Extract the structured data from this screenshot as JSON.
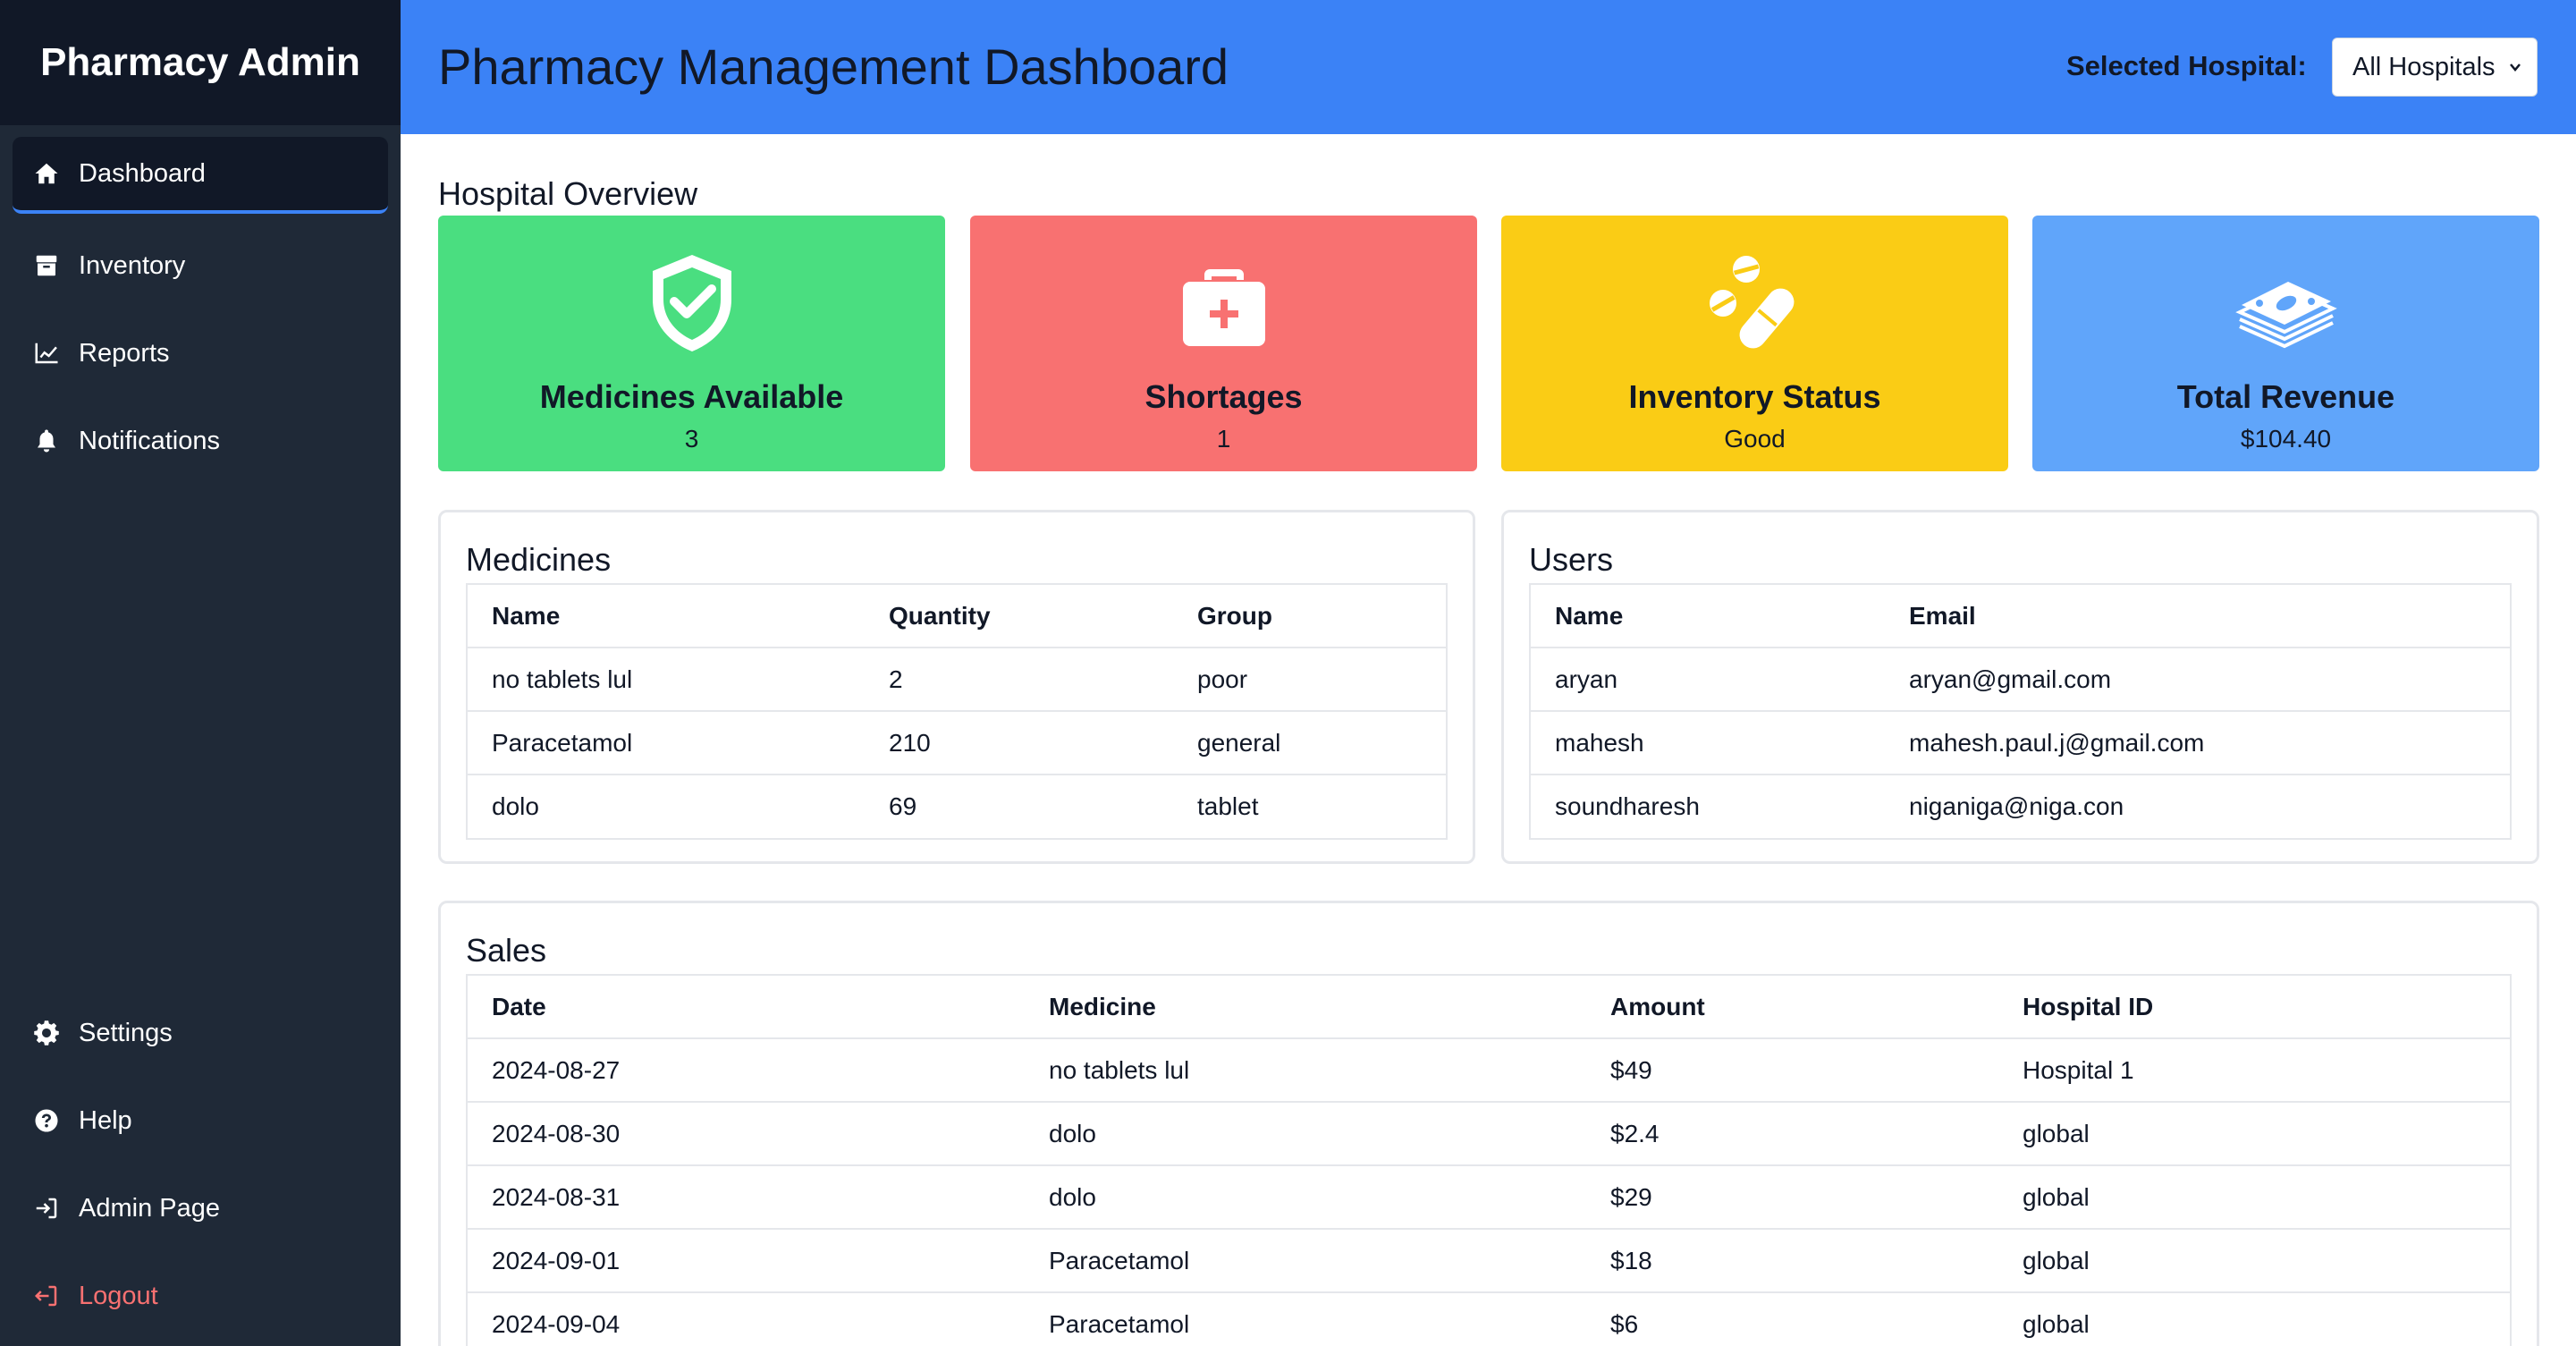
{
  "sidebar": {
    "brand": "Pharmacy Admin",
    "items": [
      {
        "label": "Dashboard",
        "icon": "home-icon"
      },
      {
        "label": "Inventory",
        "icon": "box-icon"
      },
      {
        "label": "Reports",
        "icon": "chart-line-icon"
      },
      {
        "label": "Notifications",
        "icon": "bell-icon"
      }
    ],
    "bottom_items": [
      {
        "label": "Settings",
        "icon": "gear-icon"
      },
      {
        "label": "Help",
        "icon": "question-circle-icon"
      },
      {
        "label": "Admin Page",
        "icon": "sign-in-icon"
      },
      {
        "label": "Logout",
        "icon": "sign-out-icon"
      }
    ]
  },
  "header": {
    "title": "Pharmacy Management Dashboard",
    "hospital_label": "Selected Hospital:",
    "hospital_selected": "All Hospitals"
  },
  "overview": {
    "title": "Hospital Overview",
    "cards": [
      {
        "title": "Medicines Available",
        "value": "3",
        "color": "#4ade80",
        "icon": "shield-check-icon"
      },
      {
        "title": "Shortages",
        "value": "1",
        "color": "#f87171",
        "icon": "medkit-icon"
      },
      {
        "title": "Inventory Status",
        "value": "Good",
        "color": "#facc15",
        "icon": "pills-icon"
      },
      {
        "title": "Total Revenue",
        "value": "$104.40",
        "color": "#60a5fa",
        "icon": "money-bills-icon"
      }
    ]
  },
  "medicines": {
    "title": "Medicines",
    "headers": [
      "Name",
      "Quantity",
      "Group"
    ],
    "rows": [
      [
        "no tablets lul",
        "2",
        "poor"
      ],
      [
        "Paracetamol",
        "210",
        "general"
      ],
      [
        "dolo",
        "69",
        "tablet"
      ]
    ]
  },
  "users": {
    "title": "Users",
    "headers": [
      "Name",
      "Email"
    ],
    "rows": [
      [
        "aryan",
        "aryan@gmail.com"
      ],
      [
        "mahesh",
        "mahesh.paul.j@gmail.com"
      ],
      [
        "soundharesh",
        "niganiga@niga.con"
      ]
    ]
  },
  "sales": {
    "title": "Sales",
    "headers": [
      "Date",
      "Medicine",
      "Amount",
      "Hospital ID"
    ],
    "rows": [
      [
        "2024-08-27",
        "no tablets lul",
        "$49",
        "Hospital 1"
      ],
      [
        "2024-08-30",
        "dolo",
        "$2.4",
        "global"
      ],
      [
        "2024-08-31",
        "dolo",
        "$29",
        "global"
      ],
      [
        "2024-09-01",
        "Paracetamol",
        "$18",
        "global"
      ],
      [
        "2024-09-04",
        "Paracetamol",
        "$6",
        "global"
      ]
    ]
  }
}
